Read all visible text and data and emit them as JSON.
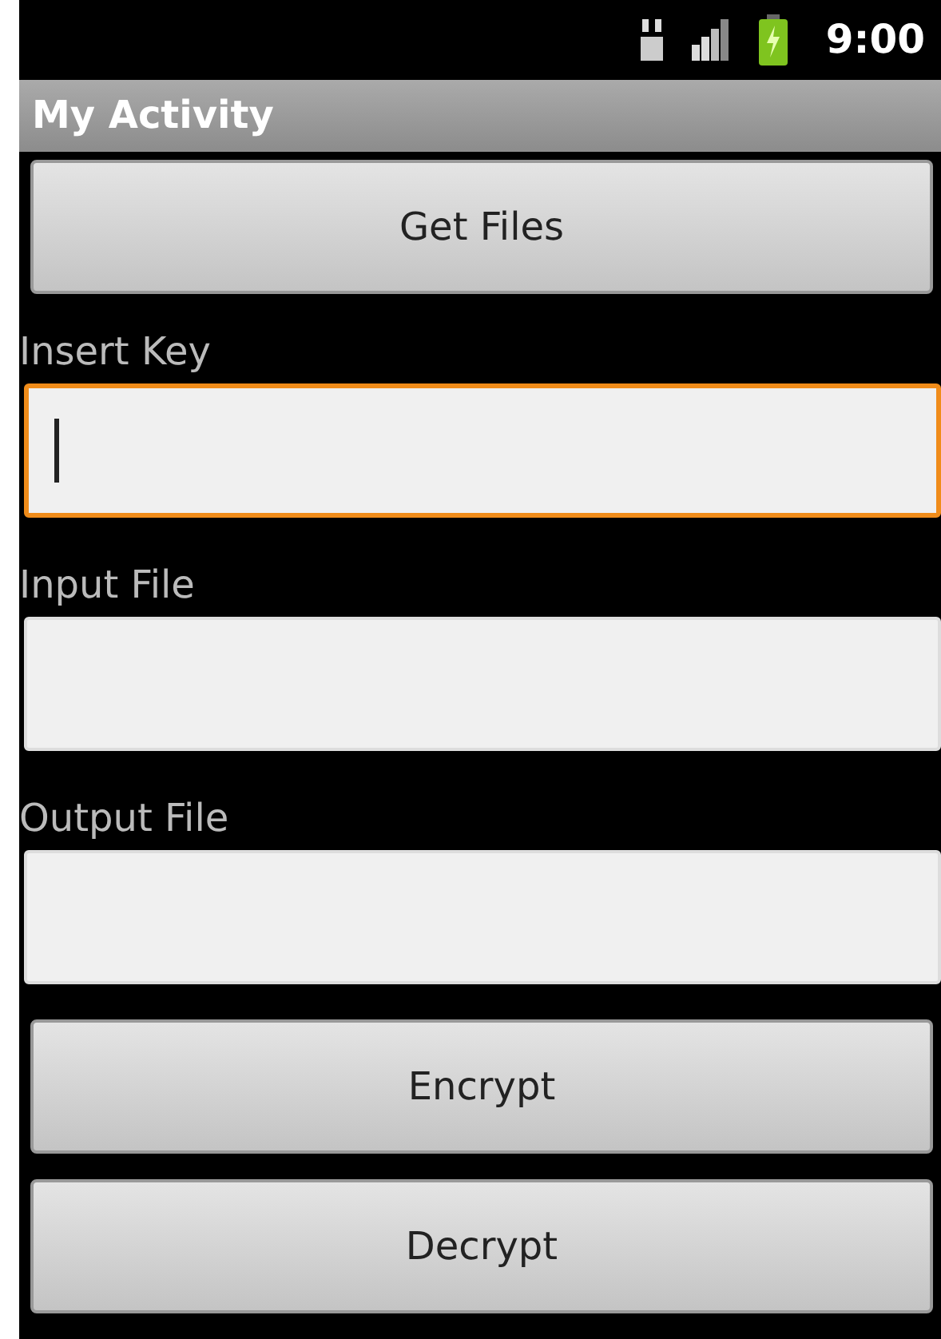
{
  "status_bar": {
    "time": "9:00"
  },
  "title_bar": {
    "title": "My Activity"
  },
  "form": [
    {
      "kind": "button",
      "label": "Get Files"
    },
    {
      "kind": "label",
      "text": "Insert Key"
    },
    {
      "kind": "field",
      "focused": true
    },
    {
      "kind": "label",
      "text": "Input File"
    },
    {
      "kind": "field",
      "focused": false
    },
    {
      "kind": "label",
      "text": "Output File"
    },
    {
      "kind": "field",
      "focused": false
    },
    {
      "kind": "button",
      "label": "Encrypt"
    },
    {
      "kind": "button",
      "label": "Decrypt"
    }
  ]
}
